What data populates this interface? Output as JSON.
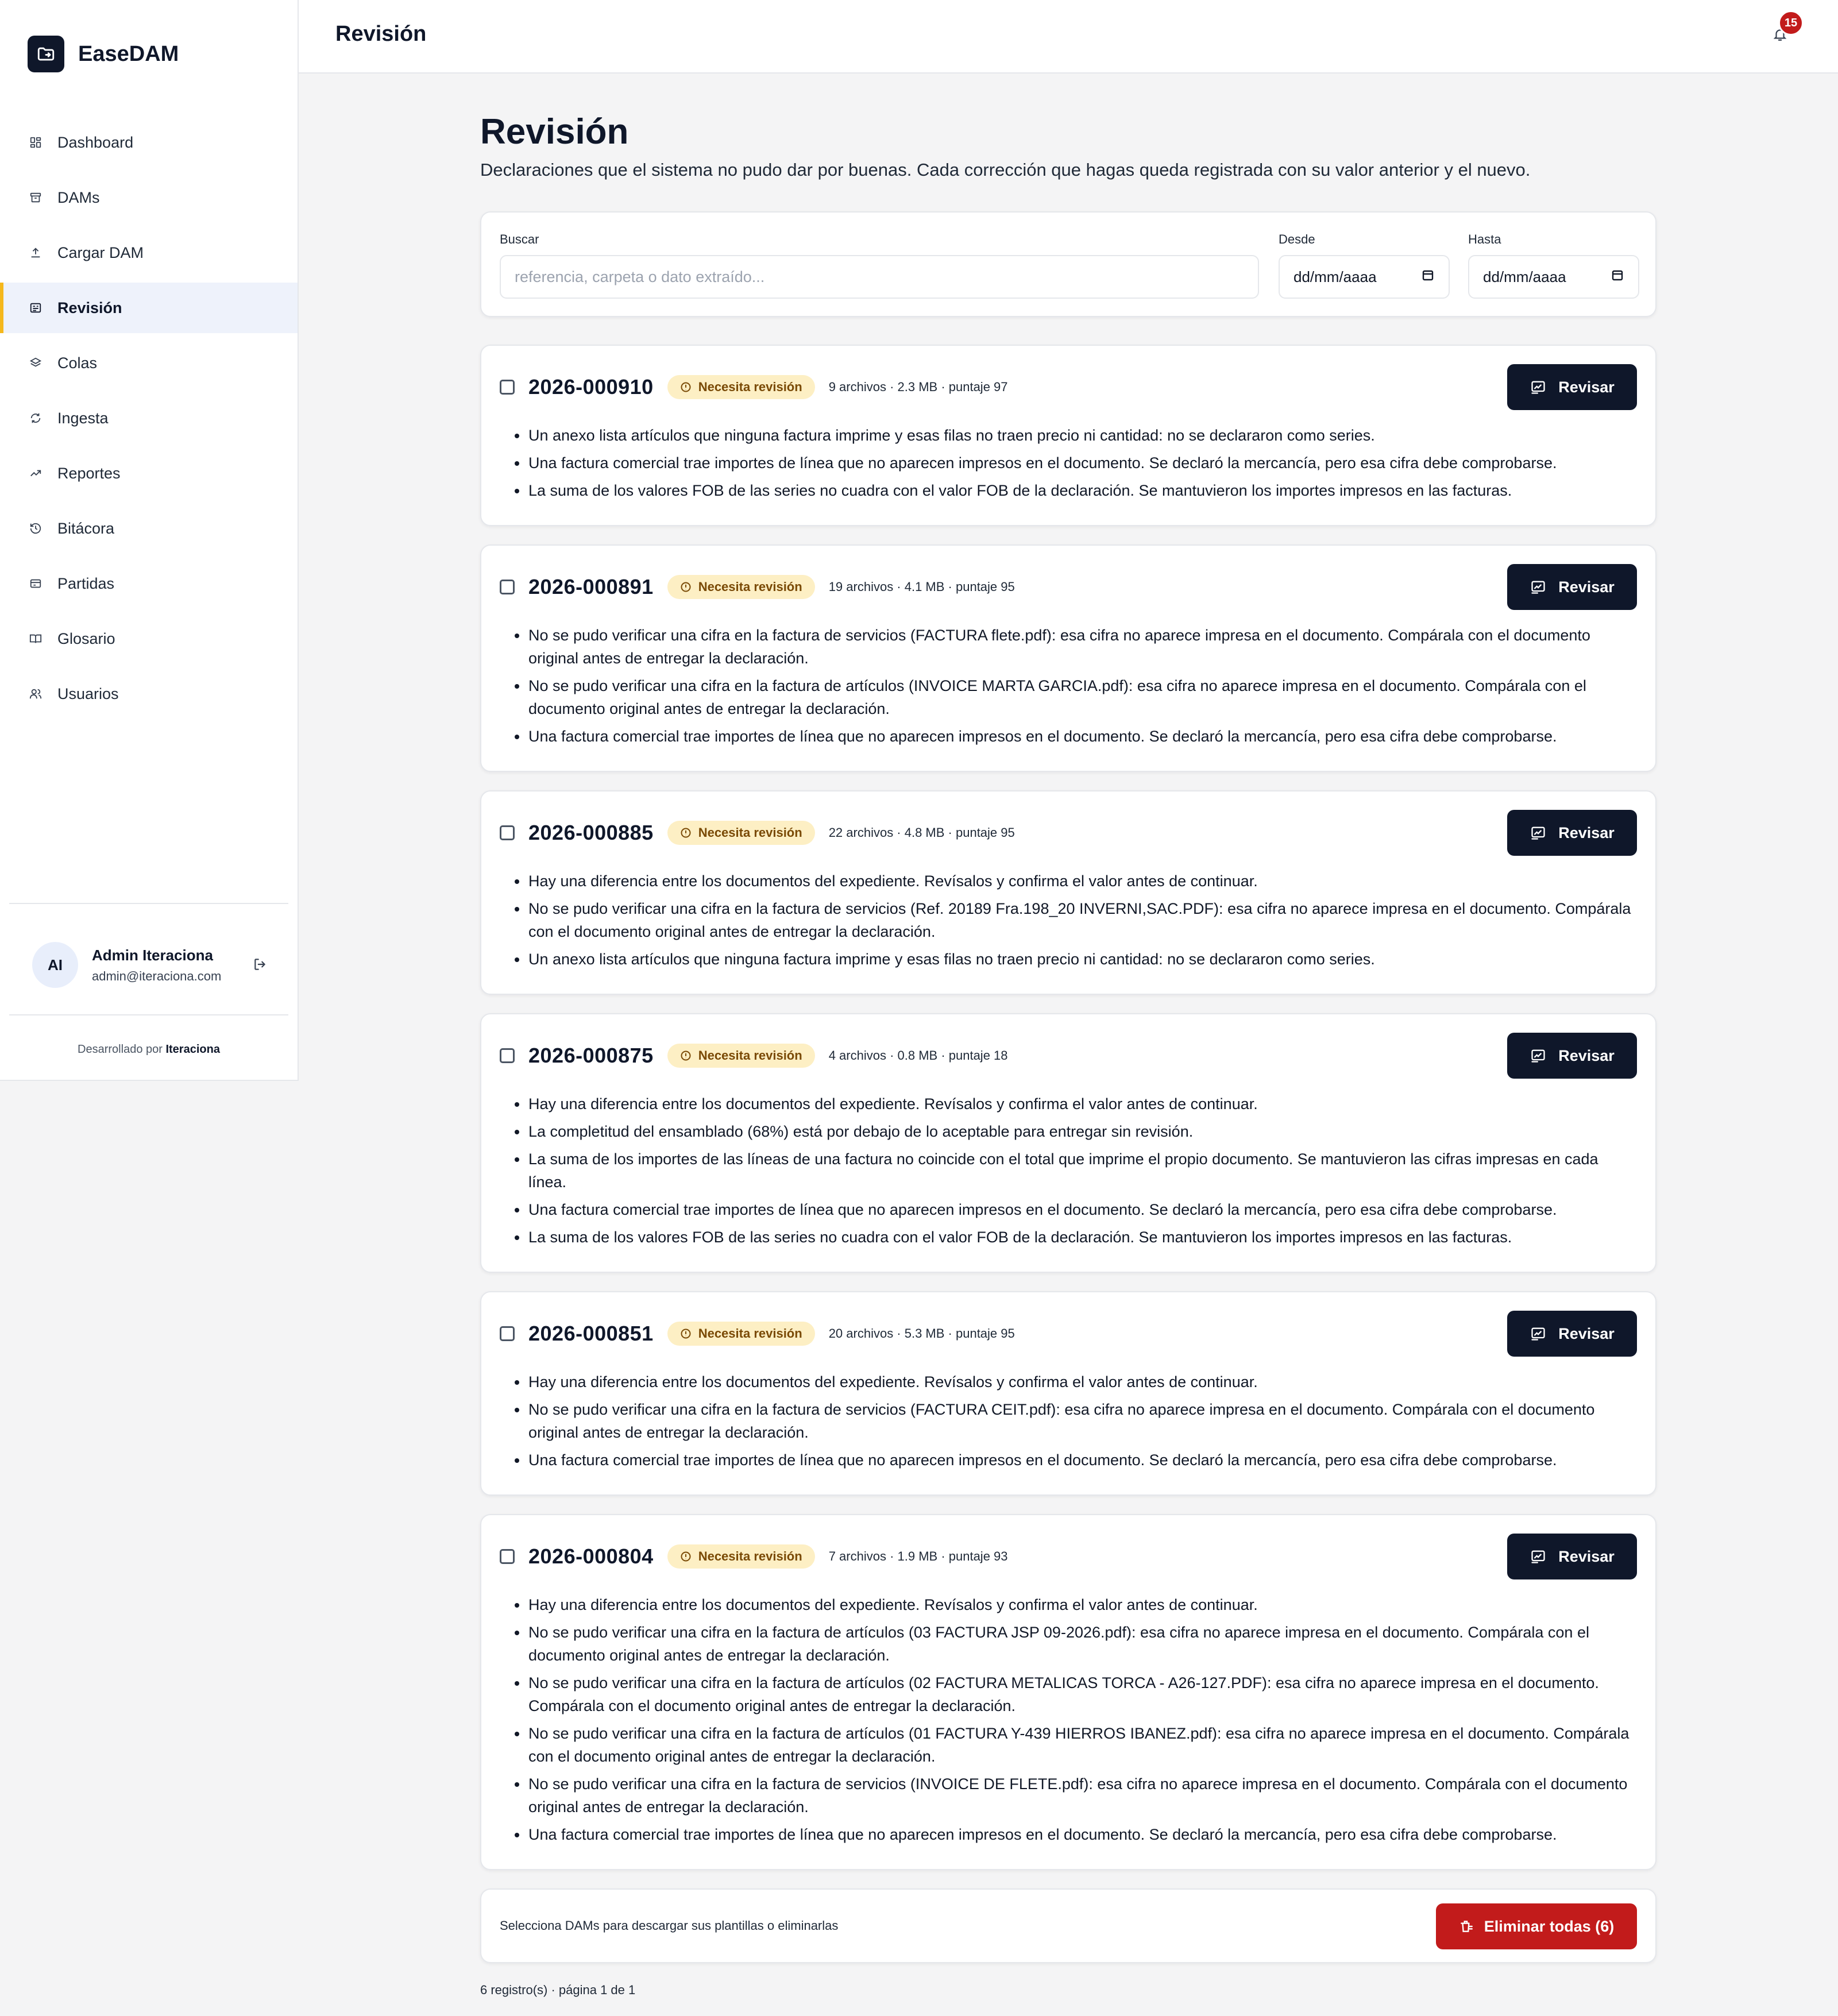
{
  "app": {
    "name": "EaseDAM"
  },
  "sidebar": {
    "items": [
      {
        "label": "Dashboard",
        "icon": "grid-icon",
        "active": false
      },
      {
        "label": "DAMs",
        "icon": "archive-icon",
        "active": false
      },
      {
        "label": "Cargar DAM",
        "icon": "upload-icon",
        "active": false
      },
      {
        "label": "Revisión",
        "icon": "review-icon",
        "active": true
      },
      {
        "label": "Colas",
        "icon": "layers-icon",
        "active": false
      },
      {
        "label": "Ingesta",
        "icon": "sync-icon",
        "active": false
      },
      {
        "label": "Reportes",
        "icon": "trend-icon",
        "active": false
      },
      {
        "label": "Bitácora",
        "icon": "history-icon",
        "active": false
      },
      {
        "label": "Partidas",
        "icon": "tag-icon",
        "active": false
      },
      {
        "label": "Glosario",
        "icon": "book-icon",
        "active": false
      },
      {
        "label": "Usuarios",
        "icon": "users-icon",
        "active": false
      }
    ],
    "user": {
      "initials": "AI",
      "name": "Admin Iteraciona",
      "email": "admin@iteraciona.com"
    },
    "credit_prefix": "Desarrollado por",
    "credit_name": "Iteraciona"
  },
  "topbar": {
    "title": "Revisión",
    "notifications": "15"
  },
  "page": {
    "title": "Revisión",
    "description": "Declaraciones que el sistema no pudo dar por buenas. Cada corrección que hagas queda registrada con su valor anterior y el nuevo."
  },
  "filters": {
    "search_label": "Buscar",
    "search_placeholder": "referencia, carpeta o dato extraído...",
    "from_label": "Desde",
    "from_value": "dd/mm/aaaa",
    "to_label": "Hasta",
    "to_value": "dd/mm/aaaa"
  },
  "review_button_label": "Revisar",
  "dams": [
    {
      "ref": "2026-000910",
      "status": "Necesita revisión",
      "meta": "9 archivos · 2.3 MB · puntaje 97",
      "issues": [
        "Un anexo lista artículos que ninguna factura imprime y esas filas no traen precio ni cantidad: no se declararon como series.",
        "Una factura comercial trae importes de línea que no aparecen impresos en el documento. Se declaró la mercancía, pero esa cifra debe comprobarse.",
        "La suma de los valores FOB de las series no cuadra con el valor FOB de la declaración. Se mantuvieron los importes impresos en las facturas."
      ]
    },
    {
      "ref": "2026-000891",
      "status": "Necesita revisión",
      "meta": "19 archivos · 4.1 MB · puntaje 95",
      "issues": [
        "No se pudo verificar una cifra en la factura de servicios (FACTURA flete.pdf): esa cifra no aparece impresa en el documento. Compárala con el documento original antes de entregar la declaración.",
        "No se pudo verificar una cifra en la factura de artículos (INVOICE MARTA GARCIA.pdf): esa cifra no aparece impresa en el documento. Compárala con el documento original antes de entregar la declaración.",
        "Una factura comercial trae importes de línea que no aparecen impresos en el documento. Se declaró la mercancía, pero esa cifra debe comprobarse."
      ]
    },
    {
      "ref": "2026-000885",
      "status": "Necesita revisión",
      "meta": "22 archivos · 4.8 MB · puntaje 95",
      "issues": [
        "Hay una diferencia entre los documentos del expediente. Revísalos y confirma el valor antes de continuar.",
        "No se pudo verificar una cifra en la factura de servicios (Ref. 20189 Fra.198_20 INVERNI,SAC.PDF): esa cifra no aparece impresa en el documento. Compárala con el documento original antes de entregar la declaración.",
        "Un anexo lista artículos que ninguna factura imprime y esas filas no traen precio ni cantidad: no se declararon como series."
      ]
    },
    {
      "ref": "2026-000875",
      "status": "Necesita revisión",
      "meta": "4 archivos · 0.8 MB · puntaje 18",
      "issues": [
        "Hay una diferencia entre los documentos del expediente. Revísalos y confirma el valor antes de continuar.",
        "La completitud del ensamblado (68%) está por debajo de lo aceptable para entregar sin revisión.",
        "La suma de los importes de las líneas de una factura no coincide con el total que imprime el propio documento. Se mantuvieron las cifras impresas en cada línea.",
        "Una factura comercial trae importes de línea que no aparecen impresos en el documento. Se declaró la mercancía, pero esa cifra debe comprobarse.",
        "La suma de los valores FOB de las series no cuadra con el valor FOB de la declaración. Se mantuvieron los importes impresos en las facturas."
      ]
    },
    {
      "ref": "2026-000851",
      "status": "Necesita revisión",
      "meta": "20 archivos · 5.3 MB · puntaje 95",
      "issues": [
        "Hay una diferencia entre los documentos del expediente. Revísalos y confirma el valor antes de continuar.",
        "No se pudo verificar una cifra en la factura de servicios (FACTURA CEIT.pdf): esa cifra no aparece impresa en el documento. Compárala con el documento original antes de entregar la declaración.",
        "Una factura comercial trae importes de línea que no aparecen impresos en el documento. Se declaró la mercancía, pero esa cifra debe comprobarse."
      ]
    },
    {
      "ref": "2026-000804",
      "status": "Necesita revisión",
      "meta": "7 archivos · 1.9 MB · puntaje 93",
      "issues": [
        "Hay una diferencia entre los documentos del expediente. Revísalos y confirma el valor antes de continuar.",
        "No se pudo verificar una cifra en la factura de artículos (03 FACTURA JSP 09-2026.pdf): esa cifra no aparece impresa en el documento. Compárala con el documento original antes de entregar la declaración.",
        "No se pudo verificar una cifra en la factura de artículos (02 FACTURA METALICAS TORCA - A26-127.PDF): esa cifra no aparece impresa en el documento. Compárala con el documento original antes de entregar la declaración.",
        "No se pudo verificar una cifra en la factura de artículos (01 FACTURA Y-439 HIERROS IBANEZ.pdf): esa cifra no aparece impresa en el documento. Compárala con el documento original antes de entregar la declaración.",
        "No se pudo verificar una cifra en la factura de servicios (INVOICE DE FLETE.pdf): esa cifra no aparece impresa en el documento. Compárala con el documento original antes de entregar la declaración.",
        "Una factura comercial trae importes de línea que no aparecen impresos en el documento. Se declaró la mercancía, pero esa cifra debe comprobarse."
      ]
    }
  ],
  "bulk": {
    "hint": "Selecciona DAMs para descargar sus plantillas o eliminarlas",
    "delete_label": "Eliminar todas (6)"
  },
  "pagination": {
    "text": "6 registro(s) · página 1 de 1"
  },
  "colors": {
    "primary": "#0f172a",
    "accent": "#f5b81c",
    "danger": "#c21b1b",
    "badge_bg": "#fdefc4"
  }
}
